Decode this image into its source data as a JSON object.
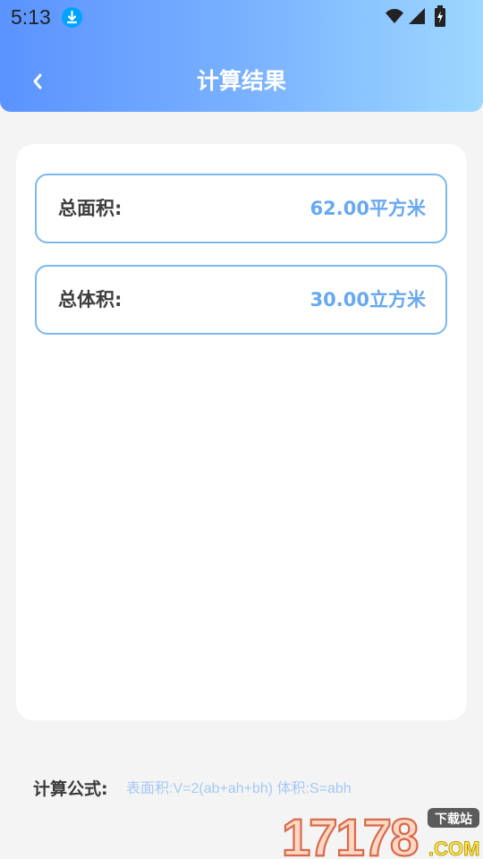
{
  "status_bar": {
    "time": "5:13",
    "icons": [
      "download-icon",
      "wifi-icon",
      "signal-icon",
      "battery-icon"
    ]
  },
  "header": {
    "title": "计算结果",
    "back_icon": "chevron-left-icon"
  },
  "results": [
    {
      "label": "总面积:",
      "value": "62.00平方米"
    },
    {
      "label": "总体积:",
      "value": "30.00立方米"
    }
  ],
  "formula": {
    "label": "计算公式:",
    "text": "表面积:V=2(ab+ah+bh) 体积:S=abh"
  },
  "watermark": {
    "brand": "17178",
    "suffix": ".COM",
    "badge": "下载站"
  },
  "colors": {
    "accent": "#67a8f0",
    "header_gradient_start": "#5a93ff",
    "header_gradient_end": "#9dd8ff",
    "background": "#f4f4f4"
  }
}
